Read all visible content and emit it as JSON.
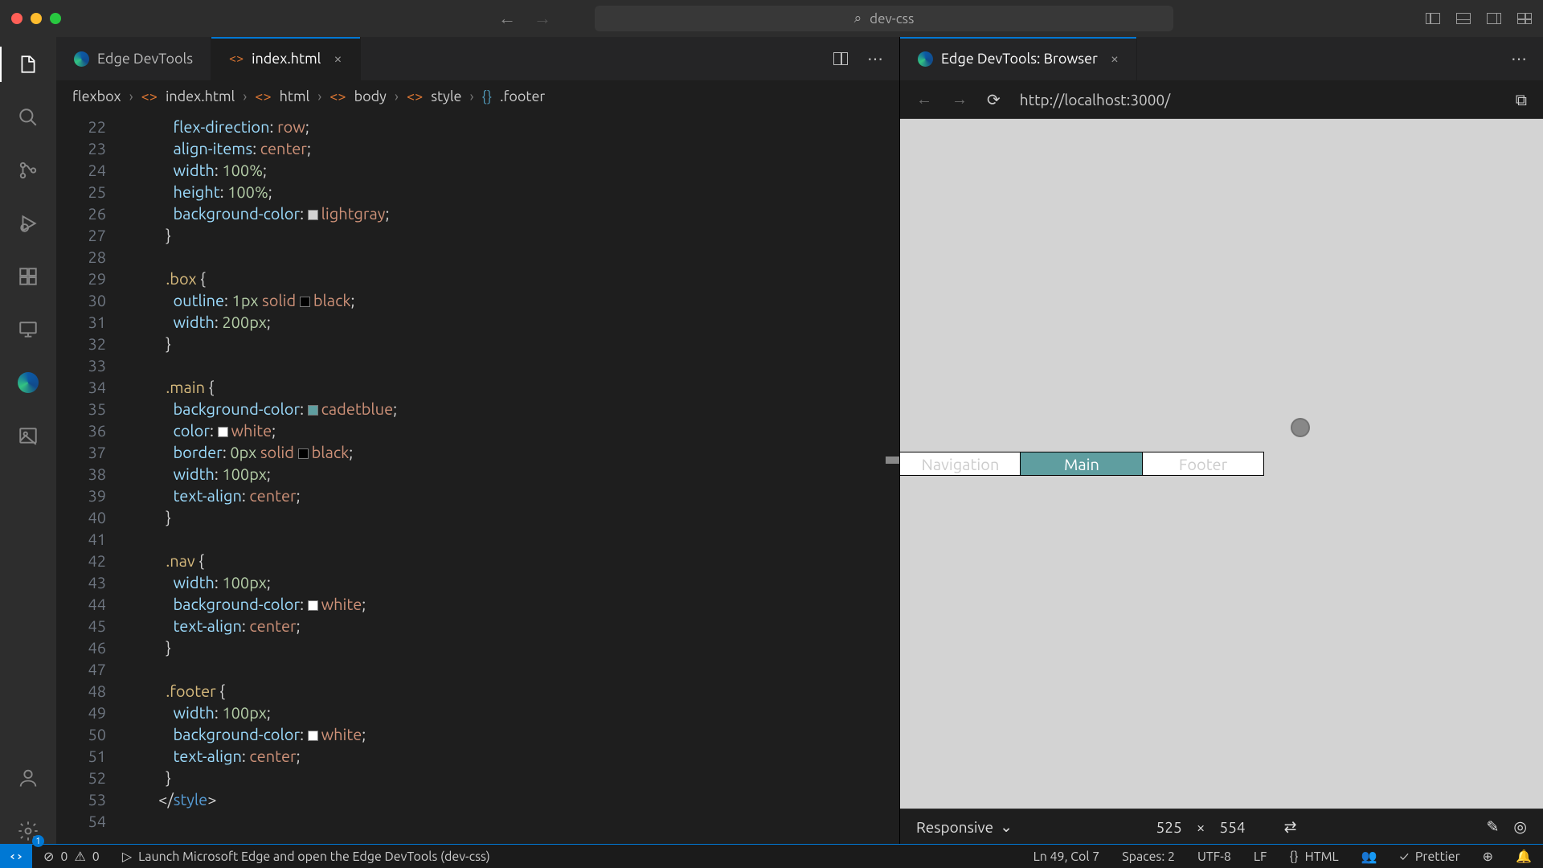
{
  "window": {
    "title": "dev-css"
  },
  "editor": {
    "tabs": [
      {
        "label": "Edge DevTools",
        "kind": "edge",
        "active": false
      },
      {
        "label": "index.html",
        "kind": "html",
        "active": true
      }
    ],
    "breadcrumb": [
      "flexbox",
      "index.html",
      "html",
      "body",
      "style",
      ".footer"
    ],
    "lines": [
      {
        "n": 22,
        "html": "      <span class='tk-prop'>flex-direction</span><span class='tk-punc'>:</span> <span class='tk-val'>row</span><span class='tk-punc'>;</span>"
      },
      {
        "n": 23,
        "html": "      <span class='tk-prop'>align-items</span><span class='tk-punc'>:</span> <span class='tk-val'>center</span><span class='tk-punc'>;</span>"
      },
      {
        "n": 24,
        "html": "      <span class='tk-prop'>width</span><span class='tk-punc'>:</span> <span class='tk-num'>100%</span><span class='tk-punc'>;</span>"
      },
      {
        "n": 25,
        "html": "      <span class='tk-prop'>height</span><span class='tk-punc'>:</span> <span class='tk-num'>100%</span><span class='tk-punc'>;</span>"
      },
      {
        "n": 26,
        "html": "      <span class='tk-prop'>background-color</span><span class='tk-punc'>:</span> <span class='tk-swatch' style='background:lightgray'></span><span class='tk-val'>lightgray</span><span class='tk-punc'>;</span>"
      },
      {
        "n": 27,
        "html": "    <span class='tk-punc'>}</span>"
      },
      {
        "n": 28,
        "html": ""
      },
      {
        "n": 29,
        "html": "    <span class='tk-sel'>.box</span> <span class='tk-punc'>{</span>"
      },
      {
        "n": 30,
        "html": "      <span class='tk-prop'>outline</span><span class='tk-punc'>:</span> <span class='tk-num'>1px</span> <span class='tk-val'>solid</span> <span class='tk-swatch' style='background:black'></span><span class='tk-val'>black</span><span class='tk-punc'>;</span>"
      },
      {
        "n": 31,
        "html": "      <span class='tk-prop'>width</span><span class='tk-punc'>:</span> <span class='tk-num'>200px</span><span class='tk-punc'>;</span>"
      },
      {
        "n": 32,
        "html": "    <span class='tk-punc'>}</span>"
      },
      {
        "n": 33,
        "html": ""
      },
      {
        "n": 34,
        "html": "    <span class='tk-sel'>.main</span> <span class='tk-punc'>{</span>"
      },
      {
        "n": 35,
        "html": "      <span class='tk-prop'>background-color</span><span class='tk-punc'>:</span> <span class='tk-swatch' style='background:cadetblue'></span><span class='tk-val'>cadetblue</span><span class='tk-punc'>;</span>"
      },
      {
        "n": 36,
        "html": "      <span class='tk-prop'>color</span><span class='tk-punc'>:</span> <span class='tk-swatch' style='background:white'></span><span class='tk-val'>white</span><span class='tk-punc'>;</span>"
      },
      {
        "n": 37,
        "html": "      <span class='tk-prop'>border</span><span class='tk-punc'>:</span> <span class='tk-num'>0px</span> <span class='tk-val'>solid</span> <span class='tk-swatch' style='background:black'></span><span class='tk-val'>black</span><span class='tk-punc'>;</span>"
      },
      {
        "n": 38,
        "html": "      <span class='tk-prop'>width</span><span class='tk-punc'>:</span> <span class='tk-num'>100px</span><span class='tk-punc'>;</span>"
      },
      {
        "n": 39,
        "html": "      <span class='tk-prop'>text-align</span><span class='tk-punc'>:</span> <span class='tk-val'>center</span><span class='tk-punc'>;</span>"
      },
      {
        "n": 40,
        "html": "    <span class='tk-punc'>}</span>"
      },
      {
        "n": 41,
        "html": ""
      },
      {
        "n": 42,
        "html": "    <span class='tk-sel'>.nav</span> <span class='tk-punc'>{</span>"
      },
      {
        "n": 43,
        "html": "      <span class='tk-prop'>width</span><span class='tk-punc'>:</span> <span class='tk-num'>100px</span><span class='tk-punc'>;</span>"
      },
      {
        "n": 44,
        "html": "      <span class='tk-prop'>background-color</span><span class='tk-punc'>:</span> <span class='tk-swatch' style='background:white'></span><span class='tk-val'>white</span><span class='tk-punc'>;</span>"
      },
      {
        "n": 45,
        "html": "      <span class='tk-prop'>text-align</span><span class='tk-punc'>:</span> <span class='tk-val'>center</span><span class='tk-punc'>;</span>"
      },
      {
        "n": 46,
        "html": "    <span class='tk-punc'>}</span>"
      },
      {
        "n": 47,
        "html": ""
      },
      {
        "n": 48,
        "html": "    <span class='tk-sel'>.footer</span> <span class='tk-punc'>{</span>"
      },
      {
        "n": 49,
        "html": "      <span class='tk-prop'>width</span><span class='tk-punc'>:</span> <span class='tk-num'>100px</span><span class='tk-punc'>;</span>"
      },
      {
        "n": 50,
        "html": "      <span class='tk-prop'>background-color</span><span class='tk-punc'>:</span> <span class='tk-swatch' style='background:white'></span><span class='tk-val'>white</span><span class='tk-punc'>;</span>"
      },
      {
        "n": 51,
        "html": "      <span class='tk-prop'>text-align</span><span class='tk-punc'>:</span> <span class='tk-val'>center</span><span class='tk-punc'>;</span>"
      },
      {
        "n": 52,
        "html": "    <span class='tk-punc'>}</span>"
      },
      {
        "n": 53,
        "html": "  <span class='tk-punc'>&lt;/</span><span class='tk-tag'>style</span><span class='tk-punc'>&gt;</span>"
      },
      {
        "n": 54,
        "html": ""
      }
    ]
  },
  "browser": {
    "tab": "Edge DevTools: Browser",
    "url": "http://localhost:3000/",
    "device": "Responsive",
    "width": "525",
    "height": "554",
    "boxes": {
      "nav": "Navigation",
      "main": "Main",
      "foot": "Footer"
    }
  },
  "status": {
    "errors": "0",
    "warnings": "0",
    "launch": "Launch Microsoft Edge and open the Edge DevTools (dev-css)",
    "pos": "Ln 49, Col 7",
    "spaces": "Spaces: 2",
    "enc": "UTF-8",
    "eol": "LF",
    "lang": "HTML",
    "prettier": "Prettier"
  }
}
